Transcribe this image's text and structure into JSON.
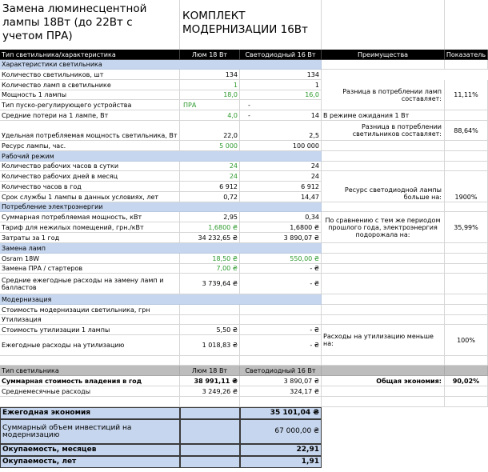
{
  "title_left": "Замена люминесцентной лампы 18Вт (до 22Вт с учетом ПРА)",
  "title_right": "КОМПЛЕКТ МОДЕРНИЗАЦИИ 16Вт",
  "header": {
    "col0": "Тип светильника/характеристика",
    "col1": "Люм 18 Вт",
    "col2": "Светодиодный 16 Вт",
    "col3": "Преимущества",
    "col4": "Показатель"
  },
  "sections": {
    "characteristics": "Характеристики светильника",
    "work_mode": "Рабочий режим",
    "power_consumption": "Потребление электроэнергии",
    "lamp_replacement": "Замена ламп",
    "modernization": "Модернизация"
  },
  "rows": {
    "fixtures_count": {
      "label": "Количество светильников, шт",
      "lum": "134",
      "led": "134"
    },
    "lamps_per_fixture": {
      "label": "Количество ламп в светильнике",
      "lum": "1",
      "led": "1"
    },
    "lamp_power": {
      "label": "Мощность 1 лампы",
      "lum": "18,0",
      "led": "16,0"
    },
    "ballast_type": {
      "label": "Тип пуско-регулирующего устройства",
      "lum": "ПРА",
      "led": "-"
    },
    "avg_loss": {
      "label": "Средние потери на 1 лампе, Вт",
      "lum": "4,0",
      "led_dash": "-",
      "led": "14"
    },
    "specific_power": {
      "label": "Удельная потребляемая мощность светильника, Вт",
      "lum": "22,0",
      "led": "2,5"
    },
    "lamp_life": {
      "label": "Ресурс лампы, час.",
      "lum": "5 000",
      "led": "100 000"
    },
    "hours_per_day": {
      "label": "Количество рабочих часов в сутки",
      "lum": "24",
      "led": "24"
    },
    "days_per_month": {
      "label": "Количество рабочих дней в месяц",
      "lum": "24",
      "led": "24"
    },
    "hours_per_year": {
      "label": "Количество часов в год",
      "lum": "6 912",
      "led": "6 912"
    },
    "service_life": {
      "label": "Срок службы 1 лампы в данных условиях, лет",
      "lum": "0,72",
      "led": "14,47"
    },
    "total_power": {
      "label": "Суммарная потребляемая мощность, кВт",
      "lum": "2,95",
      "led": "0,34"
    },
    "tariff": {
      "label": "Тариф для нежилых помещений, грн./кВт",
      "lum": "1,6800 ₴",
      "led": "1,6800 ₴"
    },
    "annual_cost": {
      "label": "Затраты за 1 год",
      "lum": "34 232,65 ₴",
      "led": "3 890,07 ₴"
    },
    "osram": {
      "label": "Osram 18W",
      "lum": "18,50 ₴",
      "led": "550,00 ₴"
    },
    "ballast_replacement": {
      "label": "Замена ПРА / стартеров",
      "lum": "7,00 ₴",
      "led": "-  ₴"
    },
    "avg_replacement": {
      "label": "Средние ежегодные расходы на замену ламп и балластов",
      "lum": "3 739,64 ₴",
      "led": "-  ₴"
    },
    "modernization_cost": {
      "label": "Стоимость модернизации светильника, грн"
    },
    "disposal": {
      "label": "Утилизация"
    },
    "disposal_cost": {
      "label": "Стоимость утилизации 1 лампы",
      "lum": "5,50 ₴",
      "led": "-  ₴"
    },
    "annual_disposal": {
      "label": "Ежегодные расходы на утилизацию",
      "lum": "1 018,83 ₴",
      "led": "-  ₴"
    }
  },
  "advantages": {
    "lamp_diff_label": "Разница в потреблении ламп составляет:",
    "lamp_diff_value": "11,11%",
    "standby_label": "В режиме ожидания 1 Вт",
    "fixture_diff_label": "Разница в потреблении светильников составляет:",
    "fixture_diff_value": "88,64%",
    "life_label": "Ресурс светодиодной лампы больше на:",
    "life_value": "1900%",
    "energy_label": "По сравнению с тем же периодом прошлого года, электроэнергия подорожала на:",
    "energy_value": "35,99%",
    "disposal_label": "Расходы на утилизацию меньше на:",
    "disposal_value": "100%"
  },
  "summary": {
    "header_col0": "Тип светильника",
    "header_col1": "Люм 18 Вт",
    "header_col2": "Светодиодный 16 Вт",
    "tco_label": "Суммарная стоимость владения в год",
    "tco_lum": "38 991,11 ₴",
    "tco_led": "3 890,07 ₴",
    "total_savings_label": "Общая экономия:",
    "total_savings_value": "90,02%",
    "monthly_label": "Среднемесячные расходы",
    "monthly_lum": "3 249,26 ₴",
    "monthly_led": "324,17 ₴"
  },
  "final": {
    "annual_savings_label": "Ежегодная экономия",
    "annual_savings_value": "35 101,04 ₴",
    "investment_label": "Суммарный объем инвестиций на модернизацию",
    "investment_value": "67 000,00 ₴",
    "payback_months_label": "Окупаемость, месяцев",
    "payback_months_value": "22,91",
    "payback_years_label": "Окупаемость, лет",
    "payback_years_value": "1,91"
  },
  "colors": {
    "section_fill": "#c6d6ee",
    "header_fill": "#000000",
    "green_text": "#2e9a2e",
    "summary_fill": "#bdbdbd"
  }
}
